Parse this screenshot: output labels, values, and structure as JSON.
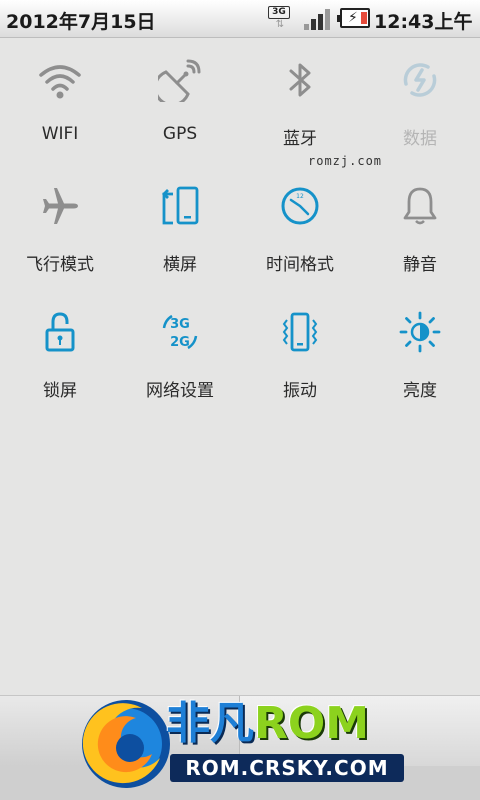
{
  "status_bar": {
    "date": "2012年7月15日",
    "network_type": "3G",
    "time": "12:43上午"
  },
  "toggles": [
    {
      "label": "WIFI",
      "icon": "wifi-icon",
      "enabled": false
    },
    {
      "label": "GPS",
      "icon": "gps-icon",
      "enabled": false
    },
    {
      "label": "蓝牙",
      "icon": "bluetooth-icon",
      "enabled": false
    },
    {
      "label": "数据",
      "icon": "mobile-data-icon",
      "enabled": false,
      "disabled": true
    },
    {
      "label": "飞行模式",
      "icon": "airplane-icon",
      "enabled": false
    },
    {
      "label": "横屏",
      "icon": "rotation-icon",
      "enabled": true
    },
    {
      "label": "时间格式",
      "icon": "clock-icon",
      "enabled": true
    },
    {
      "label": "静音",
      "icon": "bell-icon",
      "enabled": false
    },
    {
      "label": "锁屏",
      "icon": "lock-icon",
      "enabled": true
    },
    {
      "label": "网络设置",
      "icon": "network-3g2g-icon",
      "enabled": true
    },
    {
      "label": "振动",
      "icon": "vibrate-icon",
      "enabled": true
    },
    {
      "label": "亮度",
      "icon": "brightness-icon",
      "enabled": true
    }
  ],
  "watermark": "romzj.com",
  "logo": {
    "cn": "非凡",
    "rom": "ROM",
    "url": "ROM.CRSKY.COM"
  },
  "colors": {
    "active": "#1592c9",
    "inactive": "#8e8e8e",
    "disabled": "#b9cdd8"
  }
}
